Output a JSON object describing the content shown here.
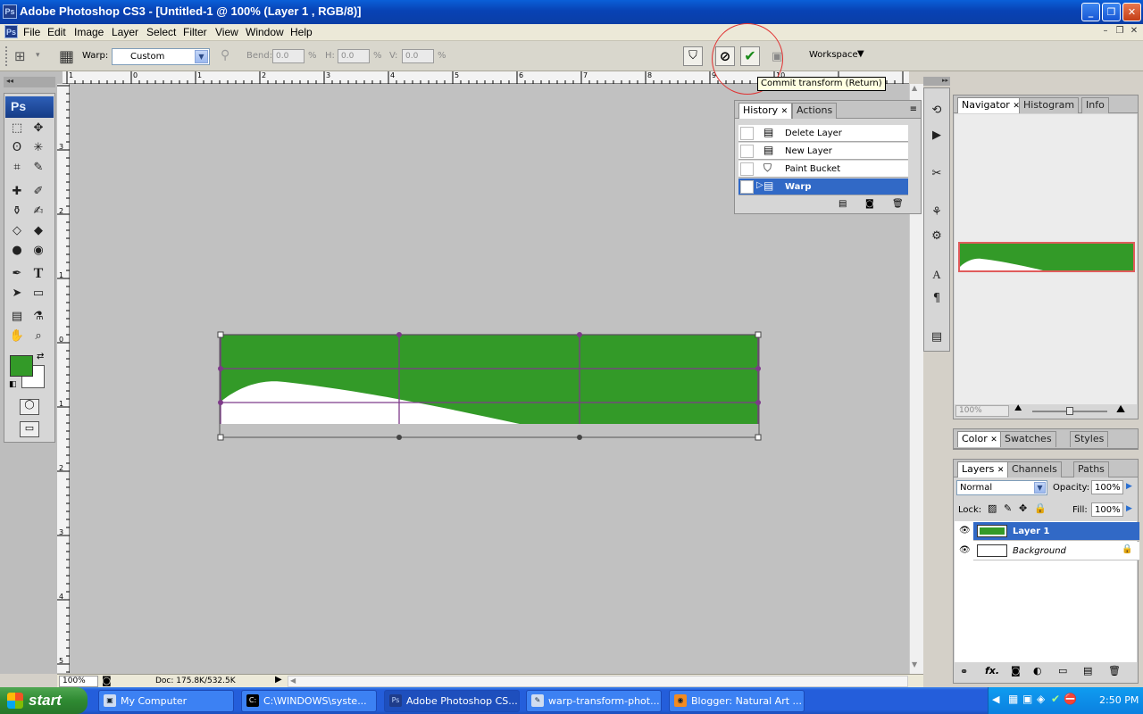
{
  "window": {
    "title": "Adobe Photoshop CS3 - [Untitled-1 @ 100% (Layer 1 , RGB/8)]",
    "app_icon": "Ps"
  },
  "menubar": {
    "items": [
      "File",
      "Edit",
      "Image",
      "Layer",
      "Select",
      "Filter",
      "View",
      "Window",
      "Help"
    ]
  },
  "options": {
    "warp_label": "Warp:",
    "warp_value": "Custom",
    "bend_label": "Bend:",
    "bend_value": "0.0",
    "h_label": "H:",
    "h_value": "0.0",
    "v_label": "V:",
    "v_value": "0.0",
    "percent": "%",
    "workspace_label": "Workspace",
    "tooltip": "Commit transform (Return)"
  },
  "rulers": {
    "top": [
      "1",
      "0",
      "1",
      "2",
      "3",
      "4",
      "5",
      "6",
      "7",
      "8",
      "9",
      "10"
    ],
    "left": [
      "3",
      "2",
      "1",
      "0",
      "1",
      "2",
      "3",
      "4",
      "5"
    ]
  },
  "toolbox": {
    "logo": "Ps",
    "fg_color": "#339a28",
    "bg_color": "#ffffff"
  },
  "canvas": {
    "fill_color": "#339a28"
  },
  "statusbar": {
    "zoom": "100%",
    "doc": "Doc: 175.8K/532.5K"
  },
  "history_panel": {
    "tabs": [
      "History",
      "Actions"
    ],
    "items": [
      {
        "name": "Delete Layer",
        "icon": "history-state-icon"
      },
      {
        "name": "New Layer",
        "icon": "history-state-icon"
      },
      {
        "name": "Paint Bucket",
        "icon": "paint-bucket-icon"
      },
      {
        "name": "Warp",
        "icon": "history-state-icon",
        "selected": true
      }
    ]
  },
  "navigator_panel": {
    "tabs": [
      "Navigator",
      "Histogram",
      "Info"
    ],
    "zoom": "100%",
    "zoom_level": 0.5
  },
  "color_panel": {
    "tabs": [
      "Color",
      "Swatches",
      "Styles"
    ]
  },
  "layers_panel": {
    "tabs": [
      "Layers",
      "Channels",
      "Paths"
    ],
    "blend_mode": "Normal",
    "opacity_label": "Opacity:",
    "opacity_value": "100%",
    "lock_label": "Lock:",
    "fill_label": "Fill:",
    "fill_value": "100%",
    "layers": [
      {
        "name": "Layer 1",
        "selected": true
      },
      {
        "name": "Background",
        "locked": true
      }
    ]
  },
  "taskbar": {
    "start": "start",
    "tasks": [
      "My Computer",
      "C:\\WINDOWS\\syste...",
      "Adobe Photoshop CS...",
      "warp-transform-phot...",
      "Blogger: Natural Art ..."
    ],
    "active_index": 2,
    "clock": "2:50 PM"
  }
}
